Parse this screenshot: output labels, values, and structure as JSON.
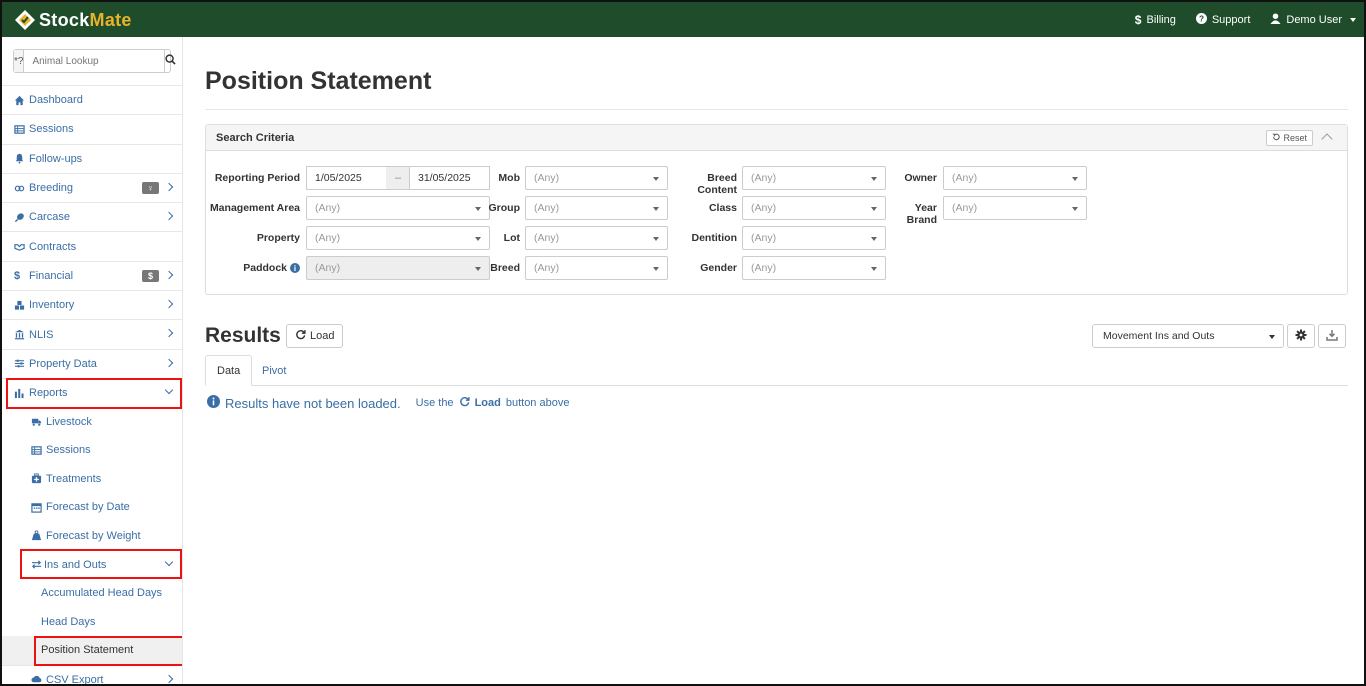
{
  "topbar": {
    "logo_stock": "Stock",
    "logo_mate": "Mate",
    "billing": "Billing",
    "support": "Support",
    "user": "Demo User"
  },
  "sidebar": {
    "lookup_prefix": "*?",
    "lookup_placeholder": "Animal Lookup",
    "items": [
      {
        "label": "Dashboard",
        "icon": "home-icon"
      },
      {
        "label": "Sessions",
        "icon": "table-icon"
      },
      {
        "label": "Follow-ups",
        "icon": "bell-icon"
      },
      {
        "label": "Breeding",
        "icon": "venus-mars-icon"
      },
      {
        "label": "Carcase",
        "icon": "drumstick-icon"
      },
      {
        "label": "Contracts",
        "icon": "handshake-icon"
      },
      {
        "label": "Financial",
        "icon": "dollar-icon"
      },
      {
        "label": "Inventory",
        "icon": "boxes-icon"
      },
      {
        "label": "NLIS",
        "icon": "bank-icon"
      },
      {
        "label": "Property Data",
        "icon": "sliders-icon"
      },
      {
        "label": "Reports",
        "icon": "bar-chart-icon"
      }
    ],
    "reports_sub": [
      {
        "label": "Livestock",
        "icon": "truck-icon"
      },
      {
        "label": "Sessions",
        "icon": "table-icon"
      },
      {
        "label": "Treatments",
        "icon": "medkit-icon"
      },
      {
        "label": "Forecast by Date",
        "icon": "calendar-icon"
      },
      {
        "label": "Forecast by Weight",
        "icon": "weight-icon"
      },
      {
        "label": "Ins and Outs",
        "icon": "exchange-icon"
      }
    ],
    "ins_outs_sub": [
      "Accumulated Head Days",
      "Head Days",
      "Position Statement"
    ],
    "csv_export": "CSV Export"
  },
  "main": {
    "title": "Position Statement",
    "panel_title": "Search Criteria",
    "reset": "Reset",
    "labels": {
      "reporting_period": "Reporting Period",
      "management_area": "Management Area",
      "property": "Property",
      "paddock": "Paddock",
      "mob": "Mob",
      "group": "Group",
      "lot": "Lot",
      "breed": "Breed",
      "breed_content": "Breed Content",
      "class": "Class",
      "dentition": "Dentition",
      "gender": "Gender",
      "owner": "Owner",
      "year_brand": "Year Brand"
    },
    "date_from": "1/05/2025",
    "date_sep": "–",
    "date_to": "31/05/2025",
    "any": "(Any)",
    "results_title": "Results",
    "load": "Load",
    "view_select": "Movement Ins and Outs",
    "tabs": [
      "Data",
      "Pivot"
    ],
    "msg_main": "Results have not been loaded.",
    "msg_use": "Use the",
    "msg_load": "Load",
    "msg_after": "button above"
  },
  "colors": {
    "topbar": "#1f4d2c",
    "accent": "#e8b22a",
    "link": "#3a6ea5",
    "highlight": "#e11111"
  }
}
